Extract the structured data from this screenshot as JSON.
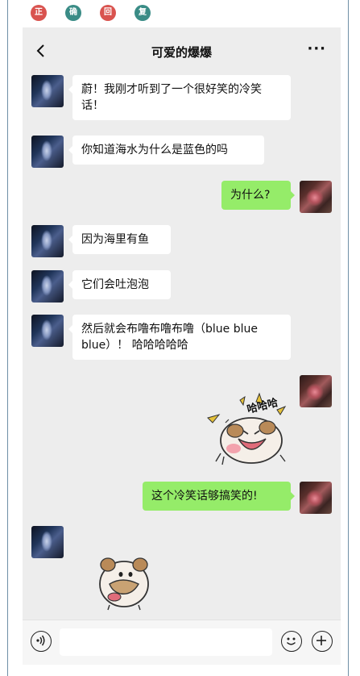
{
  "badges": [
    {
      "label": "正",
      "color": "#d9534f"
    },
    {
      "label": "确",
      "color": "#3a8c86"
    },
    {
      "label": "回",
      "color": "#d9534f"
    },
    {
      "label": "复",
      "color": "#3a8c86"
    }
  ],
  "nav": {
    "title": "可爱的爆爆",
    "more": "···"
  },
  "messages": [
    {
      "from": "friend",
      "text": "蔚！我刚才听到了一个很好笑的冷笑话！"
    },
    {
      "from": "friend",
      "text": "你知道海水为什么是蓝色的吗"
    },
    {
      "from": "me",
      "text": "为什么?"
    },
    {
      "from": "friend",
      "text": "因为海里有鱼"
    },
    {
      "from": "friend",
      "text": "它们会吐泡泡"
    },
    {
      "from": "friend",
      "text": "然后就会布噜布噜布噜（blue blue blue）！ 哈哈哈哈哈"
    },
    {
      "from": "me",
      "sticker": "laughing-poro-sticker",
      "sticker_text": "哈哈哈"
    },
    {
      "from": "me",
      "text": "这个冷笑话够搞笑的!"
    },
    {
      "from": "friend",
      "sticker": "eating-poro-sticker"
    }
  ],
  "input": {
    "value": "",
    "placeholder": ""
  }
}
